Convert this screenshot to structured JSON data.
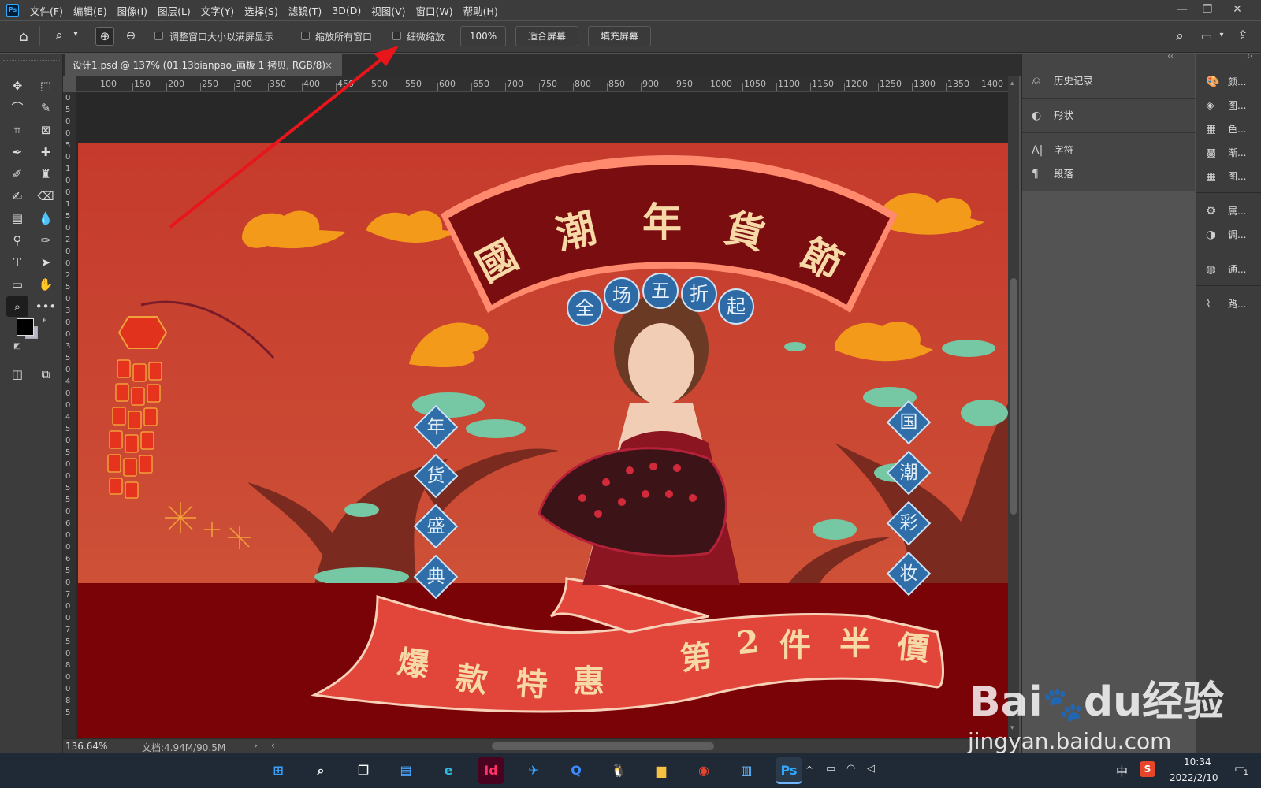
{
  "app": {
    "logo": "Ps"
  },
  "menu": [
    "文件(F)",
    "编辑(E)",
    "图像(I)",
    "图层(L)",
    "文字(Y)",
    "选择(S)",
    "滤镜(T)",
    "3D(D)",
    "视图(V)",
    "窗口(W)",
    "帮助(H)"
  ],
  "window_controls": {
    "minimize": "—",
    "restore": "❐",
    "close": "✕"
  },
  "options_bar": {
    "resize_windows_label": "调整窗口大小以满屏显示",
    "zoom_all_windows_label": "缩放所有窗口",
    "scrubby_zoom_label": "细微缩放",
    "zoom_value": "100%",
    "fit_screen_label": "适合屏幕",
    "fill_screen_label": "填充屏幕"
  },
  "document_tab": {
    "title": "设计1.psd @ 137% (01.13bianpao_画板 1 拷贝, RGB/8)",
    "close": "×"
  },
  "ruler": {
    "h_ticks": [
      "100",
      "150",
      "200",
      "250",
      "300",
      "350",
      "400",
      "450",
      "500",
      "550",
      "600",
      "650",
      "700",
      "750",
      "800",
      "850",
      "900",
      "950",
      "1000",
      "1050",
      "1100",
      "1150",
      "1200",
      "1250",
      "1300",
      "1350",
      "1400"
    ],
    "v_ticks": [
      "0",
      "5",
      "0",
      "0",
      "5",
      "0",
      "1",
      "0",
      "0",
      "1",
      "5",
      "0",
      "2",
      "0",
      "0",
      "2",
      "5",
      "0",
      "3",
      "0",
      "0",
      "3",
      "5",
      "0",
      "4",
      "0",
      "0",
      "4",
      "5",
      "0",
      "5",
      "0",
      "0",
      "5",
      "5",
      "0",
      "6",
      "0",
      "0",
      "6",
      "5",
      "0",
      "7",
      "0",
      "0",
      "7",
      "5",
      "0",
      "8",
      "0",
      "0",
      "8",
      "5"
    ]
  },
  "artwork": {
    "banner_title": [
      "國",
      "潮",
      "年",
      "貨",
      "節"
    ],
    "circle_text": [
      "全",
      "场",
      "五",
      "折",
      "起"
    ],
    "left_diamonds": [
      "年",
      "货",
      "盛",
      "典"
    ],
    "right_diamonds": [
      "国",
      "潮",
      "彩",
      "妆"
    ],
    "ribbon_left": [
      "爆",
      "款",
      "特",
      "惠"
    ],
    "ribbon_right": [
      "第",
      "2",
      "件",
      "半",
      "價"
    ],
    "colors": {
      "background": "#c94432",
      "banner": "#7a0d0f",
      "ribbon": "#e2453a",
      "diamond": "#2f6ea8",
      "cloud": "#f39a1a",
      "title_text": "#f6d9a6"
    }
  },
  "history_panel": [
    {
      "icon": "history-icon",
      "label": "历史记录"
    },
    {
      "icon": "shape-icon",
      "label": "形状"
    },
    {
      "icon": "character-icon",
      "label": "字符"
    },
    {
      "icon": "paragraph-icon",
      "label": "段落"
    }
  ],
  "right_dock": [
    {
      "icon": "palette-icon",
      "label": "颜..."
    },
    {
      "icon": "layers-icon",
      "label": "图..."
    },
    {
      "icon": "swatches-icon",
      "label": "色..."
    },
    {
      "icon": "gradient-icon",
      "label": "渐..."
    },
    {
      "icon": "patterns-icon",
      "label": "图..."
    },
    {
      "icon": "properties-icon",
      "label": "属..."
    },
    {
      "icon": "adjustments-icon",
      "label": "调..."
    },
    {
      "icon": "channels-icon",
      "label": "通..."
    },
    {
      "icon": "paths-icon",
      "label": "路..."
    }
  ],
  "status": {
    "zoom": "136.64%",
    "doc": "文档:4.94M/90.5M"
  },
  "taskbar": {
    "apps": [
      {
        "name": "start",
        "glyph": "⊞",
        "color": "#3aa0ff"
      },
      {
        "name": "search",
        "glyph": "⌕",
        "color": "#ffffff"
      },
      {
        "name": "task-view",
        "glyph": "❐",
        "color": "#ffffff"
      },
      {
        "name": "widgets",
        "glyph": "▤",
        "color": "#4aa3ff"
      },
      {
        "name": "edge",
        "glyph": "e",
        "color": "#2fbbdf"
      },
      {
        "name": "indesign",
        "glyph": "Id",
        "color": "#ff3366"
      },
      {
        "name": "feishu",
        "glyph": "✈",
        "color": "#38a7ff"
      },
      {
        "name": "quark",
        "glyph": "Q",
        "color": "#3c8bff"
      },
      {
        "name": "qq",
        "glyph": "🐧",
        "color": "#ffffff"
      },
      {
        "name": "explorer",
        "glyph": "▆",
        "color": "#f5c242"
      },
      {
        "name": "chrome",
        "glyph": "◉",
        "color": "#e6442f"
      },
      {
        "name": "notepad",
        "glyph": "▥",
        "color": "#62b6ff"
      },
      {
        "name": "photoshop",
        "glyph": "Ps",
        "color": "#31a8ff"
      }
    ],
    "ime": "中",
    "time": "10:34",
    "date": "2022/2/10",
    "notif_count": "1"
  },
  "watermark": {
    "brand": "Bai",
    "brand2": "du",
    "cn": "经验",
    "url": "jingyan.baidu.com"
  }
}
